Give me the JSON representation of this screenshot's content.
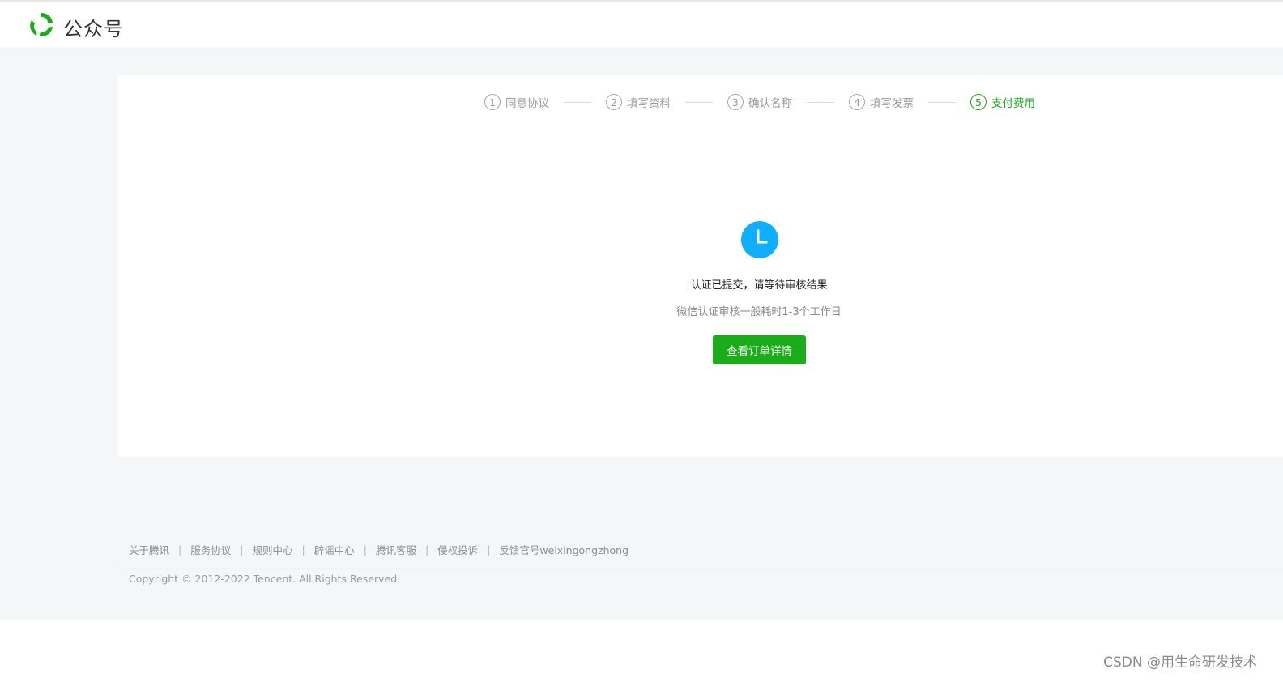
{
  "header": {
    "brand": "公众号"
  },
  "steps": [
    {
      "num": "1",
      "label": "同意协议",
      "active": false
    },
    {
      "num": "2",
      "label": "填写资料",
      "active": false
    },
    {
      "num": "3",
      "label": "确认名称",
      "active": false
    },
    {
      "num": "4",
      "label": "填写发票",
      "active": false
    },
    {
      "num": "5",
      "label": "支付费用",
      "active": true
    }
  ],
  "status": {
    "icon": "clock-icon",
    "title": "认证已提交，请等待审核结果",
    "description": "微信认证审核一般耗时1-3个工作日",
    "button_label": "查看订单详情"
  },
  "footer": {
    "links": [
      "关于腾讯",
      "服务协议",
      "规则中心",
      "辟谣中心",
      "腾讯客服",
      "侵权投诉",
      "反馈官号weixingongzhong"
    ],
    "separator": "|",
    "copyright": "Copyright © 2012-2022 Tencent. All Rights Reserved."
  },
  "watermark": "CSDN @用生命研发技术",
  "colors": {
    "accent_green": "#1aad19",
    "status_blue": "#10aeff",
    "page_bg": "#f5f6f7"
  }
}
